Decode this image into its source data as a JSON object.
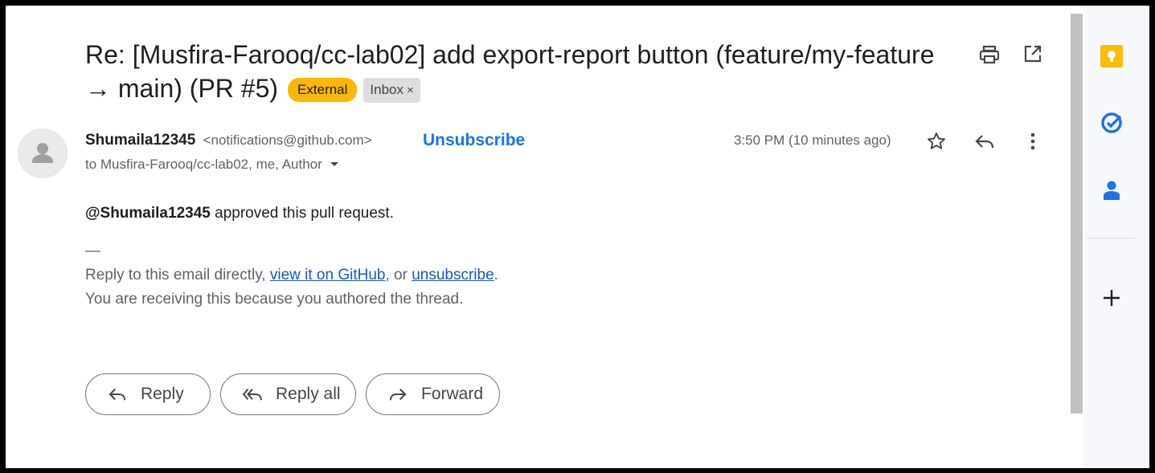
{
  "email": {
    "subject": "Re: [Musfira-Farooq/cc-lab02] add export-report button (feature/my-feature → main) (PR #5)",
    "labels": {
      "external": "External",
      "inbox": "Inbox",
      "inbox_remove": "×"
    },
    "sender_name": "Shumaila12345",
    "sender_email": "<notifications@github.com>",
    "unsubscribe_label": "Unsubscribe",
    "recipients": "to Musfira-Farooq/cc-lab02, me, Author",
    "time": "3:50 PM (10 minutes ago)",
    "body": {
      "mention": "@Shumaila12345",
      "text": " approved this pull request."
    },
    "signature": {
      "dash": "—",
      "prefix": "Reply to this email directly, ",
      "link_view": "view it on GitHub",
      "middle": ", or ",
      "link_unsub": "unsubscribe",
      "suffix": ".",
      "line2": "You are receiving this because you authored the thread."
    }
  },
  "actions": {
    "reply": "Reply",
    "reply_all": "Reply all",
    "forward": "Forward"
  },
  "icons": {
    "print": "print-icon",
    "open_new_window": "open-in-new-window-icon",
    "star": "star-icon",
    "reply": "reply-icon",
    "more": "more-vert-icon",
    "keep": "keep-icon",
    "tasks": "tasks-icon",
    "contacts": "contacts-icon",
    "add": "add-icon"
  },
  "colors": {
    "external_chip": "#f9b806",
    "link": "#1a73e8",
    "keep_yellow": "#fbbc04",
    "tasks_blue": "#1a73e8"
  }
}
